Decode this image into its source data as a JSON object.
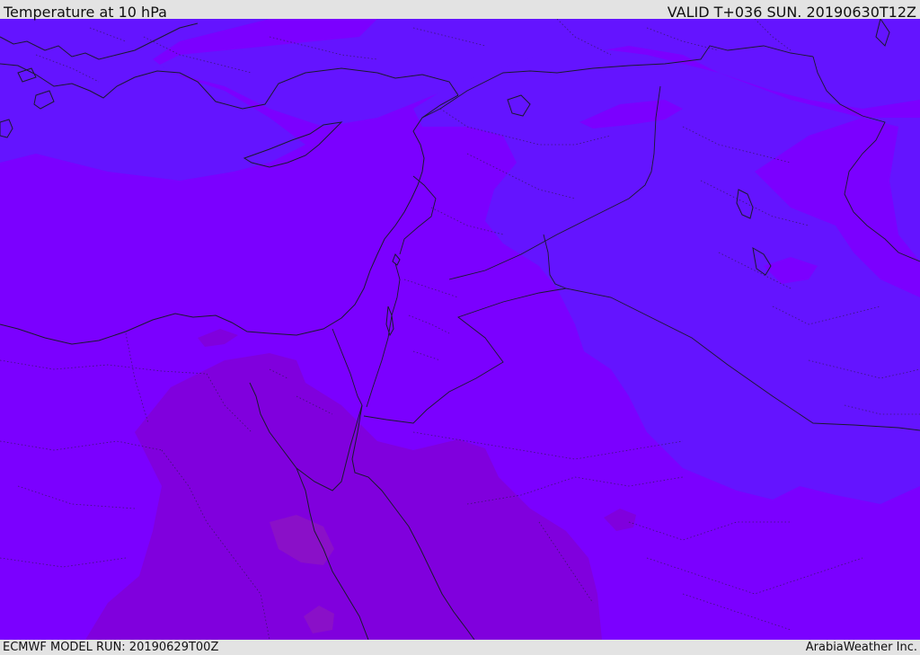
{
  "header": {
    "title": "Temperature at 10 hPa",
    "valid": "VALID T+036 SUN. 20190630T12Z"
  },
  "footer": {
    "model_run": "ECMWF MODEL RUN: 20190629T00Z",
    "credit": "ArabiaWeather Inc."
  },
  "colors": {
    "band_warm": "#7b00ff",
    "band_cool": "#6414ff",
    "band_warmer": "#8000dd",
    "band_warmest": "#8a10c8",
    "frame": "#e3e3e3"
  }
}
